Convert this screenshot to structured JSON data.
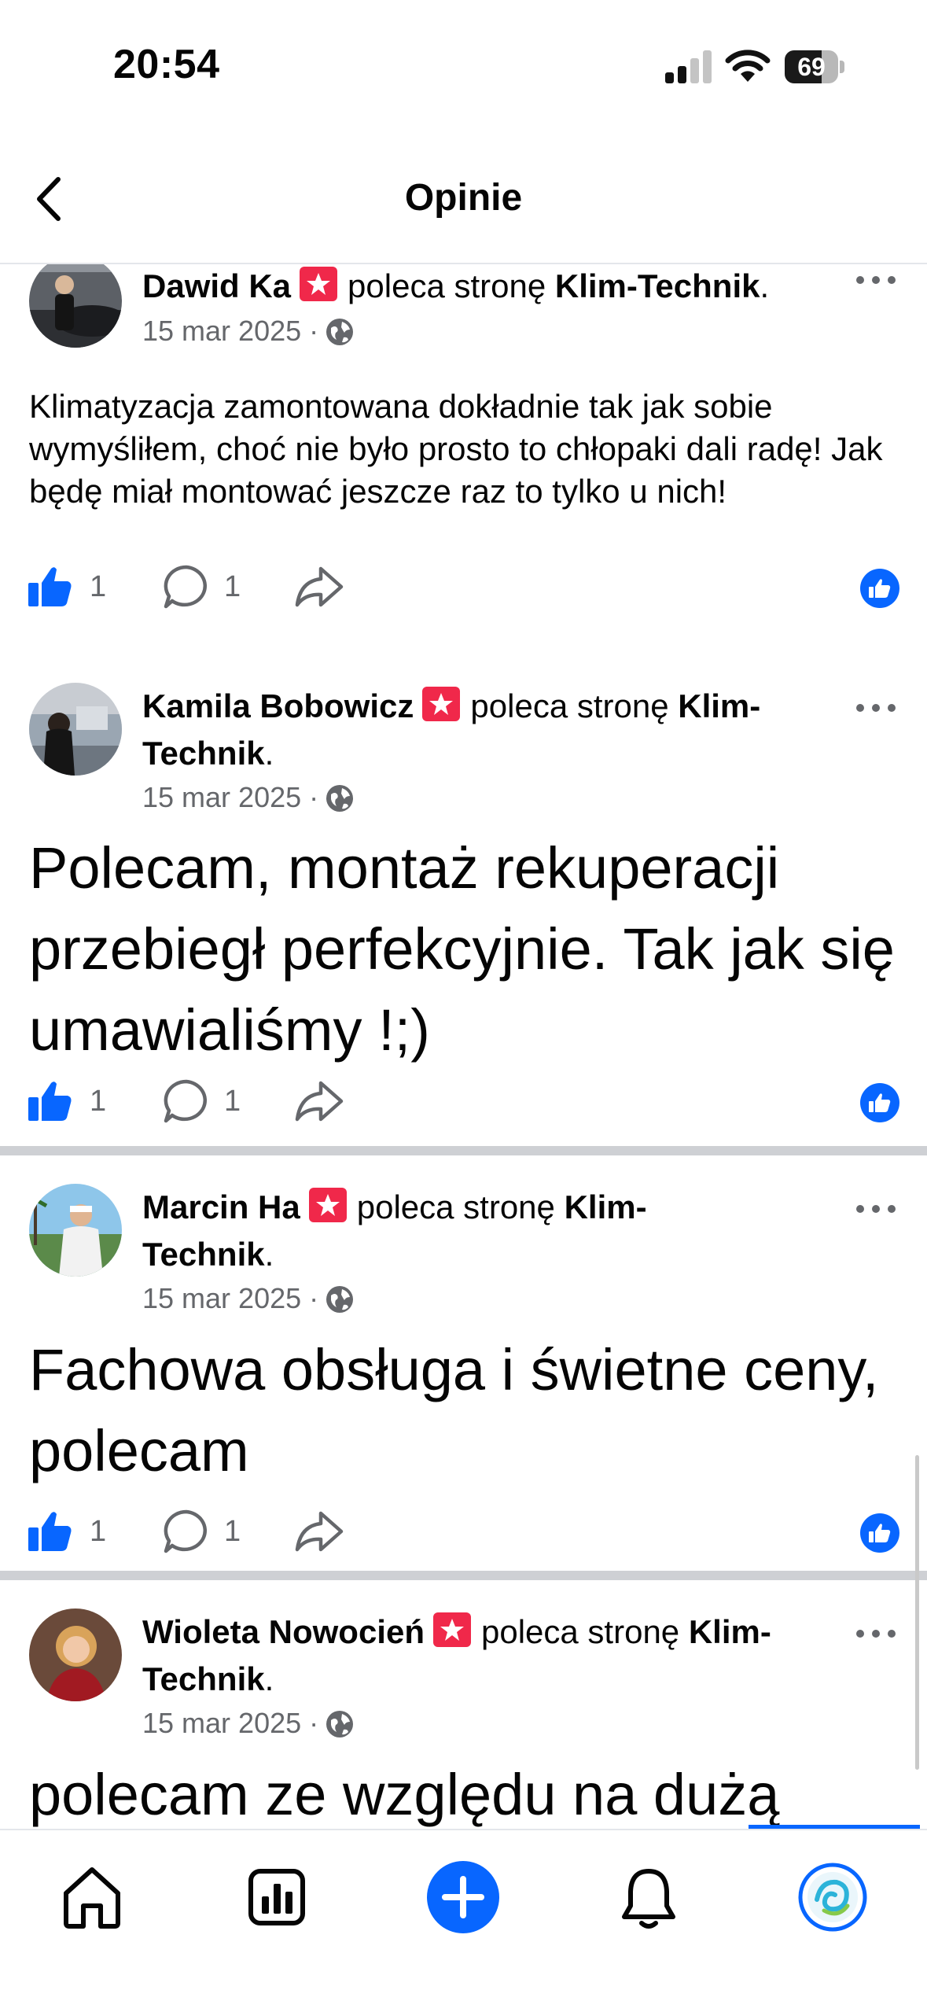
{
  "status_bar": {
    "time": "20:54",
    "battery": "69",
    "battery_level": 0.69
  },
  "header": {
    "title": "Opinie"
  },
  "recommend_text": "poleca stronę",
  "posts": [
    {
      "author": "Dawid Ka",
      "page_first": "Klim-Technik",
      "page_second": "",
      "page_end": ".",
      "date": "15 mar 2025 ·",
      "body": "Klimatyzacja zamontowana dokładnie tak jak sobie wymyśliłem, choć nie było prosto to chłopaki dali radę! Jak będę miał montować jeszcze raz to tylko u nich!",
      "likes": "1",
      "comments": "1"
    },
    {
      "author": "Kamila Bobowicz",
      "page_first": "Klim-",
      "page_second": "Technik",
      "page_end": ".",
      "date": "15 mar 2025 ·",
      "body": "Polecam, montaż rekuperacji przebiegł perfekcyjnie. Tak jak się umawialiśmy !;)",
      "likes": "1",
      "comments": "1"
    },
    {
      "author": "Marcin Ha",
      "page_first": "Klim-",
      "page_second": "Technik",
      "page_end": ".",
      "date": "15 mar 2025 ·",
      "body": "Fachowa obsługa i świetne ceny, polecam",
      "likes": "1",
      "comments": "1"
    },
    {
      "author": "Wioleta Nowocień",
      "page_first": "Klim-",
      "page_second": "Technik",
      "page_end": ".",
      "date": "15 mar 2025 ·",
      "body": "polecam ze względu na dużą",
      "likes": "",
      "comments": ""
    }
  ],
  "colors": {
    "brand_blue": "#0866ff",
    "recommend_red": "#f0284a",
    "meta_gray": "#65676b"
  },
  "tabs": [
    "home-icon",
    "insights-icon",
    "create-icon",
    "notifications-icon",
    "profile-icon"
  ]
}
